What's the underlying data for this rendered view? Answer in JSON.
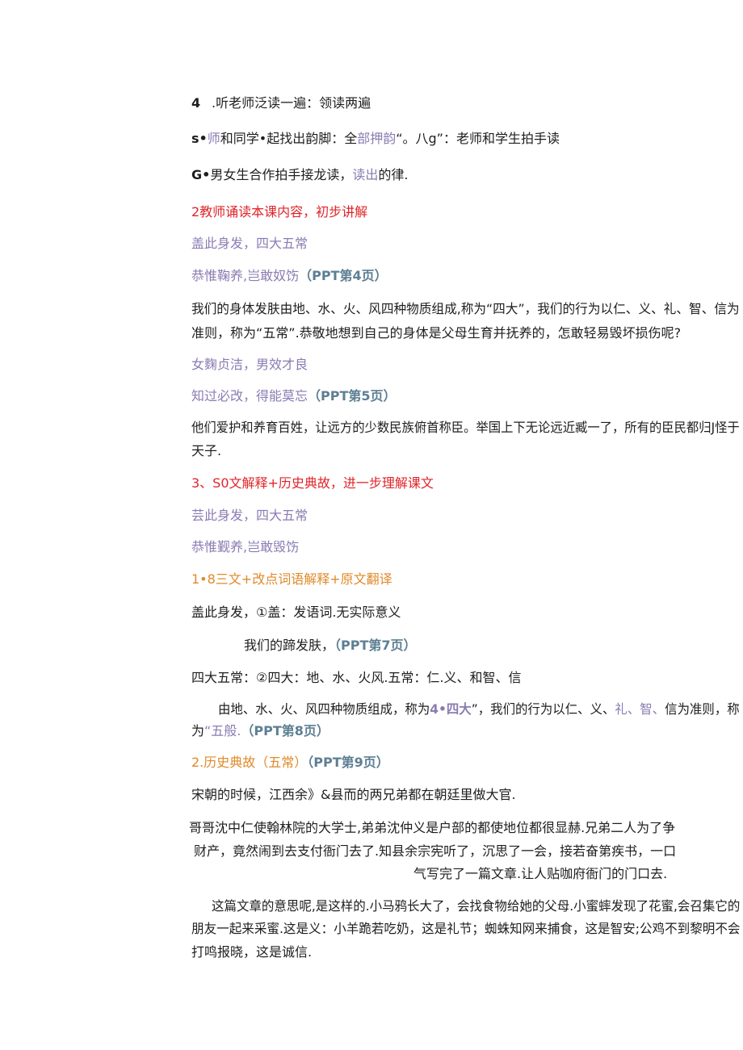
{
  "lines": {
    "l1a": "4",
    "l1b": ".听老师泛读一遍：领读两遍",
    "l2a": "s•",
    "l2b": "师",
    "l2c": "和同学•起找出韵脚：全",
    "l2d": "部押韵",
    "l2e": "“。八g”：老师和学生拍手读",
    "l3a": "G•",
    "l3b": "男女生合作拍手接龙读，",
    "l3c": "读出",
    "l3d": "的律.",
    "l4": "2教师诵读本课内容，初步讲解",
    "l5": "盖此身发，四大五常",
    "l6a": "恭惟鞠养,岂敢奴饬",
    "l6b": "（PPT第4页）",
    "p1": "我们的身体发肤由地、水、火、风四种物质组成,称为“四大”，我们的行为以仁、义、礼、智、信为",
    "p1b": "准则，称为“五常”.恭敬地想到自己的身体是父母生育并抚养的，怎敢轻易毁坏损伤呢?",
    "l7": "女麴贞洁，男效才良",
    "l8a": "知过必改，得能莫忘",
    "l8b": "（PPT第5页）",
    "p2": "他们爱护和养育百姓，让远方的少数民族俯首称臣。举国上下无论远近臧一了，所有的臣民都归J怪于",
    "p2b": "天子.",
    "l9": "3、S0文解释+历史典故，进一步理解课文",
    "l10": "芸此身发，四大五常",
    "l11": "恭惟觐养,岂敢毁饬",
    "l12": "1•8三文+改点词语解释+原文翻译",
    "l13": "盖此身发，①盖：发语词.无实际意义",
    "l14a": "我们的蹄发肤，",
    "l14b": "（PPT第7页）",
    "l15": "四大五常：②四大：地、水、火风.五常：仁.义、和智、信",
    "l16a": "由地、水、火、风四种物质组成，称为",
    "l16b": "4•四大",
    "l16c": "”，我们的行为以仁、义、",
    "l16d": "礼、智、",
    "l16e": "信为准则，称",
    "l17a": "为",
    "l17b": "“五般.",
    "l17c": "（PPT第8页）",
    "l18a": "2.历史典故（五常）",
    "l18b": "（PPT第9页）",
    "l19": "宋朝的时候，江西余》&县而的两兄弟都在朝廷里做大官.",
    "l20": "哥哥沈中仁使翰林院的大学士,弟弟沈仲义是户部的都使地位都很显赫.兄弟二人为了争",
    "l21": "财产，竟然闹到去支付衙门去了.知县余宗宪听了，沉思了一会，接若奋第疾书，一口",
    "l22": "气写完了一篇文章.让人贴咖府衙门的门口去.",
    "l23": "这篇文章的意思呢,是这样的.小马鸦长大了，会找食物给她的父母.小蜜蟀发现了花蜜,会召集它的",
    "l24": "朋友一起来采蜜.这是义：小羊跪若吃奶，这是礼节；蜘蛛知网来捕食，这是智安;公鸡不到黎明不会",
    "l25": "打鸣报晓，这是诚信."
  }
}
